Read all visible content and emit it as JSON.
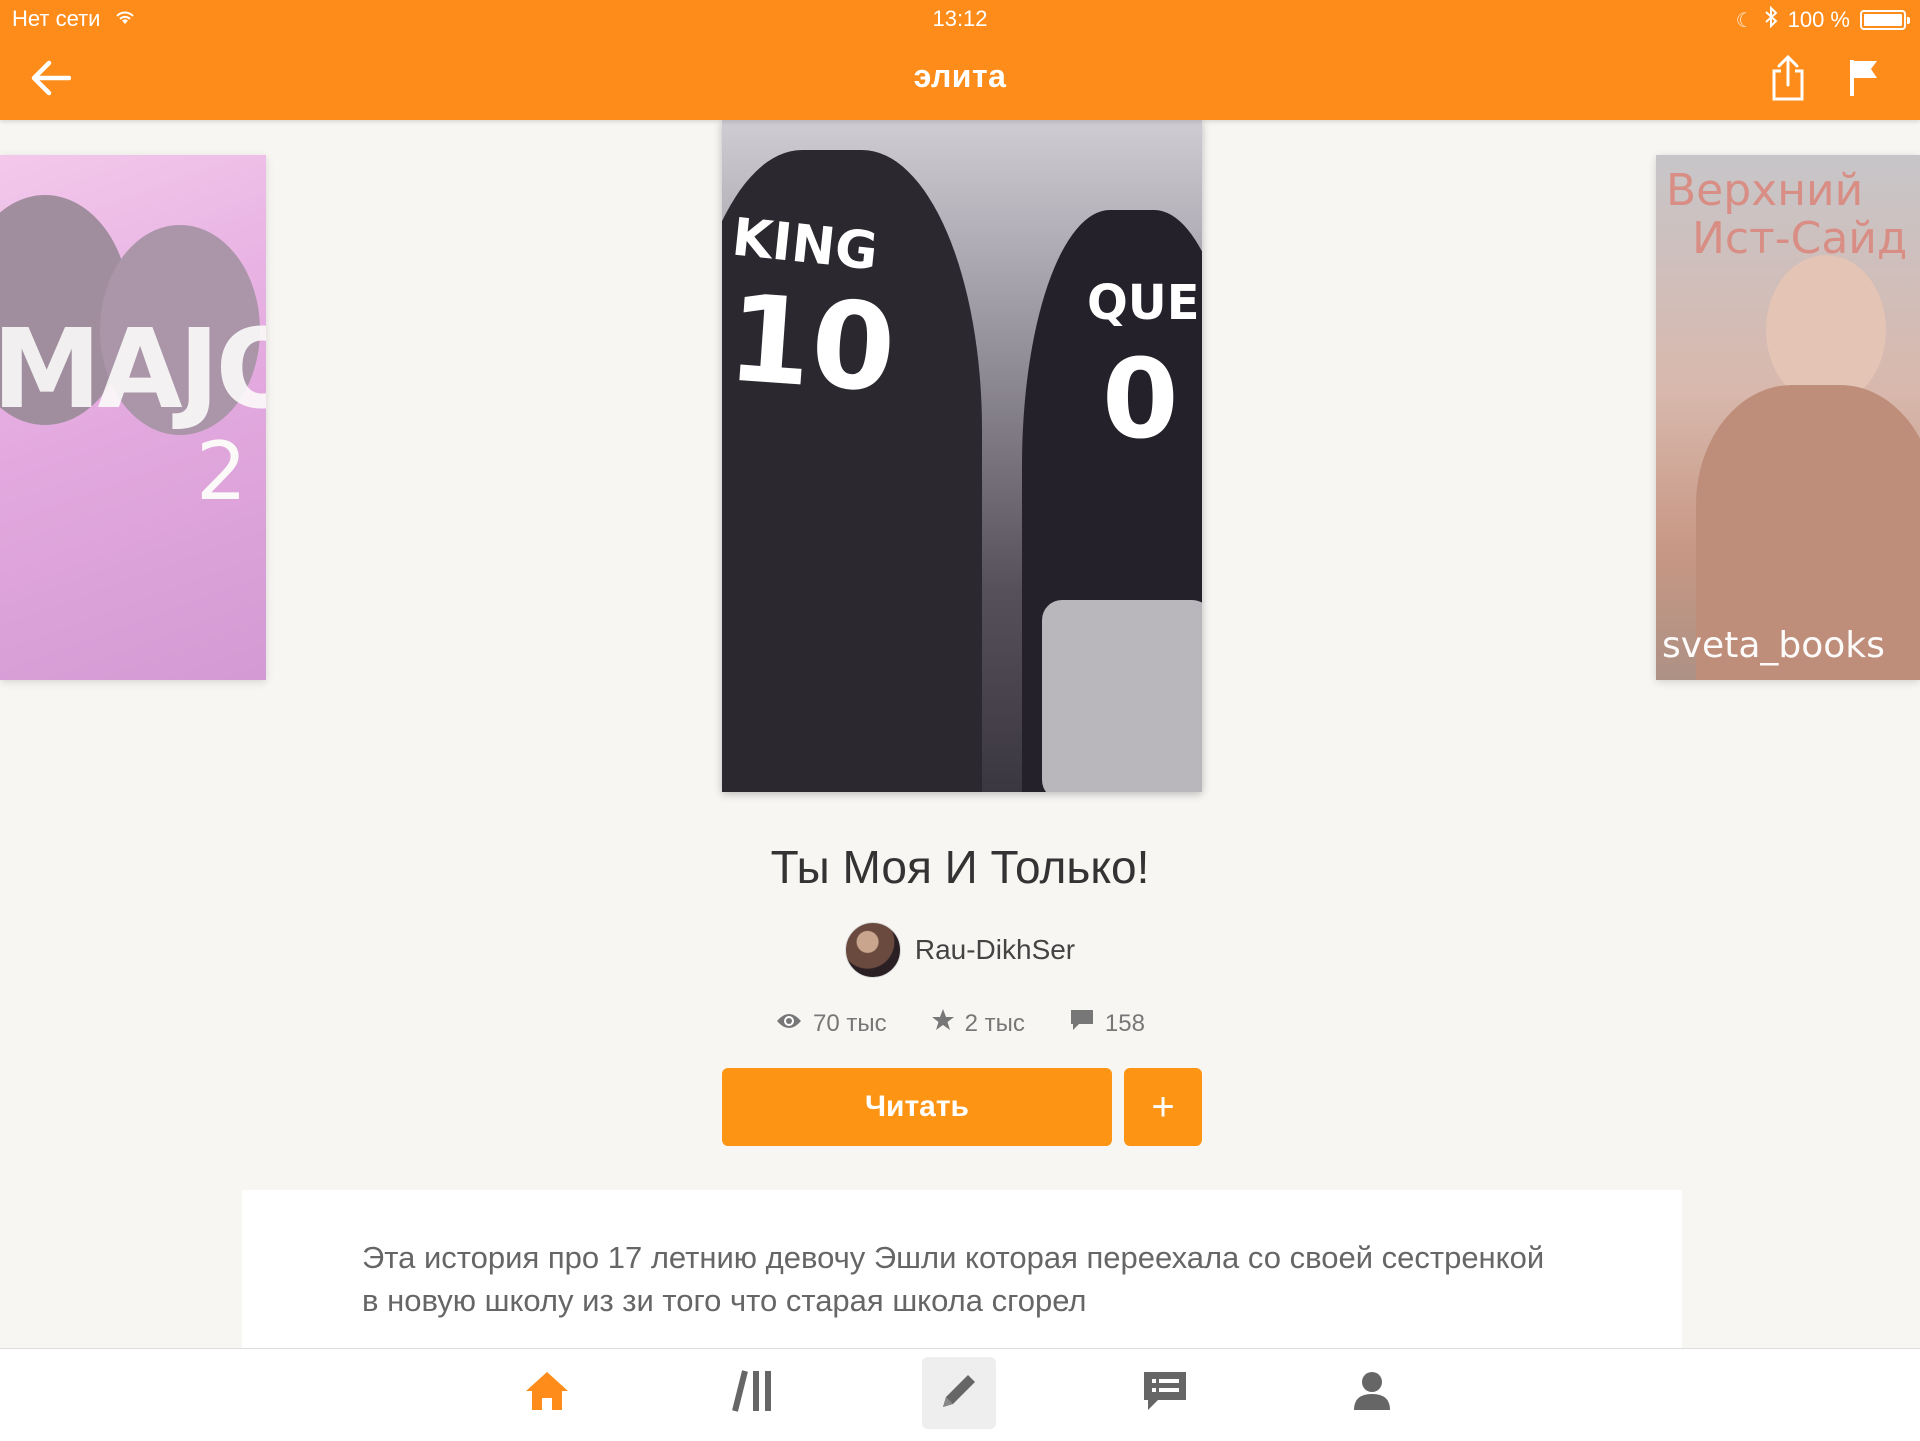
{
  "status_bar": {
    "carrier": "Нет сети",
    "time": "13:12",
    "battery": "100 %"
  },
  "nav": {
    "title": "элита",
    "icons": [
      "back-arrow-icon",
      "share-icon",
      "flag-icon"
    ]
  },
  "covers": {
    "left": {
      "title": "MAJOR",
      "number": "2"
    },
    "center": {
      "shirt_left_text": "KING",
      "shirt_left_number": "10",
      "shirt_right_text": "QUE",
      "shirt_right_number": "0"
    },
    "right": {
      "title_line1": "Верхний",
      "title_line2": "Ист-Сайд",
      "credit": "sveta_books"
    }
  },
  "book": {
    "title": "Ты Моя И Только!",
    "author": "Rau-DikhSer",
    "stats": {
      "views": "70 тыс",
      "votes": "2 тыс",
      "comments": "158"
    },
    "read_label": "Читать",
    "add_label": "+",
    "description": "Эта история про 17 летнию девочу Эшли которая переехала со своей сестренкой в новую школу из зи того что старая школа сгорел"
  },
  "tabbar": {
    "tabs": [
      "home-icon",
      "library-icon",
      "write-icon",
      "messages-icon",
      "profile-icon"
    ],
    "active": "home-icon"
  },
  "colors": {
    "accent": "#fd8c1b",
    "button": "#fd9414",
    "background": "#f8f6f3"
  }
}
